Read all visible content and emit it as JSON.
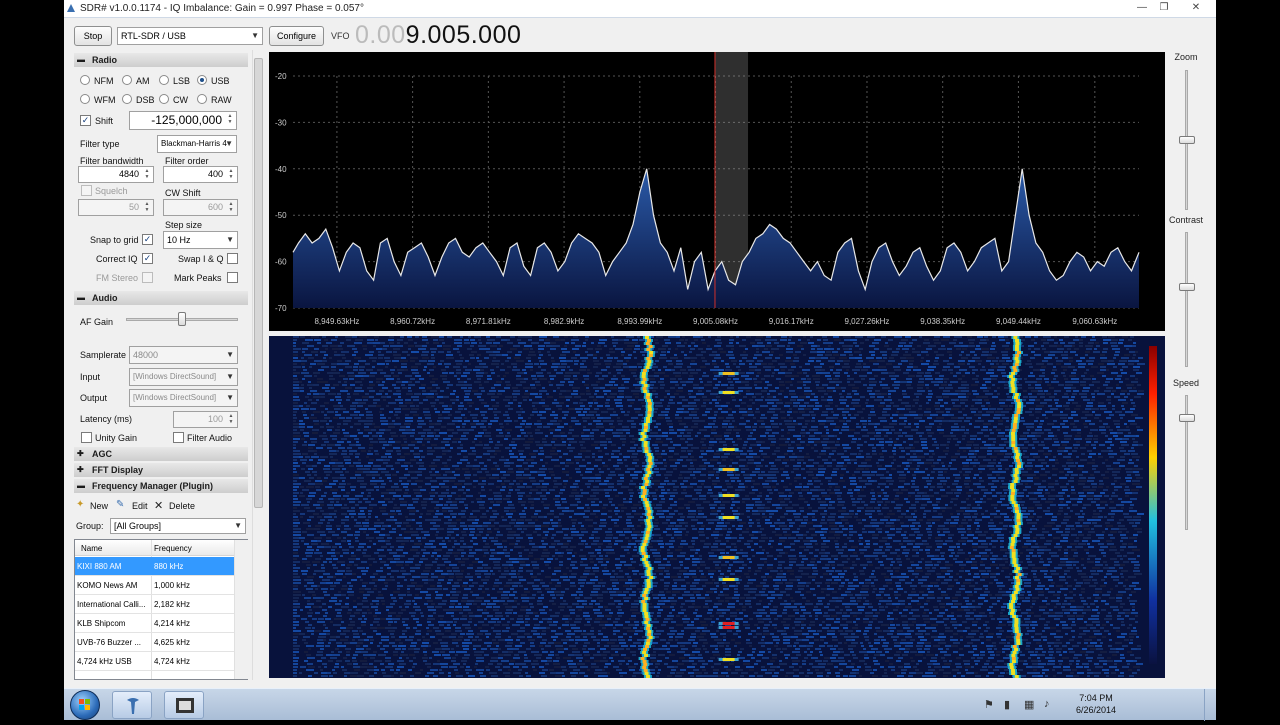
{
  "window": {
    "title": "SDR# v1.0.0.1174 - IQ Imbalance: Gain = 0.997 Phase = 0.057°",
    "minimize": "—",
    "maximize": "❐",
    "close": "✕"
  },
  "toolbar": {
    "stop_label": "Stop",
    "source_value": "RTL-SDR / USB",
    "configure_label": "Configure",
    "vfo_label": "VFO",
    "vfo_dim": "0.00",
    "vfo_value": "9.005.000"
  },
  "radio": {
    "header": "Radio",
    "toggle": "▬",
    "modes": [
      {
        "label": "NFM",
        "selected": false
      },
      {
        "label": "AM",
        "selected": false
      },
      {
        "label": "LSB",
        "selected": false
      },
      {
        "label": "USB",
        "selected": true
      },
      {
        "label": "WFM",
        "selected": false
      },
      {
        "label": "DSB",
        "selected": false
      },
      {
        "label": "CW",
        "selected": false
      },
      {
        "label": "RAW",
        "selected": false
      }
    ],
    "shift_label": "Shift",
    "shift_value": "-125,000,000",
    "filter_type_label": "Filter type",
    "filter_type_value": "Blackman-Harris 4",
    "filter_bandwidth_label": "Filter bandwidth",
    "filter_bandwidth_value": "4840",
    "filter_order_label": "Filter order",
    "filter_order_value": "400",
    "squelch_label": "Squelch",
    "squelch_value": "50",
    "cw_shift_label": "CW Shift",
    "cw_shift_value": "600",
    "step_size_label": "Step size",
    "step_size_value": "10 Hz",
    "snap_label": "Snap to grid",
    "correct_iq_label": "Correct IQ",
    "swap_iq_label": "Swap I & Q",
    "fm_stereo_label": "FM Stereo",
    "mark_peaks_label": "Mark Peaks",
    "check_mark": "✓"
  },
  "audio": {
    "header": "Audio",
    "toggle": "▬",
    "af_gain_label": "AF Gain",
    "af_gain_level": 0.5,
    "samplerate_label": "Samplerate",
    "samplerate_value": "48000",
    "input_label": "Input",
    "input_value": "[Windows DirectSound]",
    "output_label": "Output",
    "output_value": "[Windows DirectSound]",
    "latency_label": "Latency (ms)",
    "latency_value": "100",
    "unity_gain_label": "Unity Gain",
    "filter_audio_label": "Filter Audio"
  },
  "collapsed_sections": [
    {
      "label": "AGC",
      "toggle": "✚"
    },
    {
      "label": "FFT Display",
      "toggle": "✚"
    }
  ],
  "freq_manager": {
    "header": "Frequency Manager (Plugin)",
    "toggle": "▬",
    "new_label": "New",
    "edit_label": "Edit",
    "delete_label": "Delete",
    "group_label": "Group:",
    "group_value": "[All Groups]",
    "columns": [
      "Name",
      "Frequency"
    ],
    "rows": [
      {
        "name": "KIXI 880 AM",
        "freq": "880 kHz"
      },
      {
        "name": "KOMO News AM",
        "freq": "1,000 kHz"
      },
      {
        "name": "International Calli...",
        "freq": "2,182 kHz"
      },
      {
        "name": "KLB Shipcom",
        "freq": "4,214 kHz"
      },
      {
        "name": "UVB-76 Buzzer ...",
        "freq": "4,625 kHz"
      },
      {
        "name": "4,724 kHz USB",
        "freq": "4,724 kHz"
      }
    ]
  },
  "right_panel": {
    "zoom_label": "Zoom",
    "contrast_label": "Contrast",
    "speed_label": "Speed",
    "zoom_level": 0.5,
    "contrast_level": 0.6,
    "speed_level": 0.15
  },
  "taskbar": {
    "time": "7:04 PM",
    "date": "6/26/2014",
    "tray_icons": [
      "flag-icon",
      "battery-icon",
      "network-icon",
      "speaker-icon"
    ]
  },
  "chart_data": {
    "type": "line",
    "title": "",
    "xlabel": "",
    "ylabel": "",
    "ylim": [
      -70,
      -20
    ],
    "xlim": [
      8943.2,
      9067.1
    ],
    "y_ticks": [
      "-20",
      "-30",
      "-40",
      "-50",
      "-60",
      "-70"
    ],
    "x_ticks": [
      {
        "value": 8949.63,
        "label": "8,949.63kHz"
      },
      {
        "value": 8960.72,
        "label": "8,960.72kHz"
      },
      {
        "value": 8971.81,
        "label": "8,971.81kHz"
      },
      {
        "value": 8982.9,
        "label": "8,982.9kHz"
      },
      {
        "value": 8993.99,
        "label": "8,993.99kHz"
      },
      {
        "value": 9005.08,
        "label": "9,005.08kHz"
      },
      {
        "value": 9016.17,
        "label": "9,016.17kHz"
      },
      {
        "value": 9027.26,
        "label": "9,027.26kHz"
      },
      {
        "value": 9038.35,
        "label": "9,038.35kHz"
      },
      {
        "value": 9049.44,
        "label": "9,049.44kHz"
      },
      {
        "value": 9060.63,
        "label": "9,060.63kHz"
      }
    ],
    "vfo_khz": 9005.0,
    "filter_khz": [
      9005.0,
      9009.84
    ],
    "series": [
      {
        "x": [
          8943.2,
          8944.0,
          8945.0,
          8946.0,
          8947.0,
          8948.0,
          8949.0,
          8950.0,
          8951.0,
          8952.0,
          8953.0,
          8954.0,
          8955.0,
          8956.0,
          8957.0,
          8958.0,
          8959.0,
          8960.0,
          8961.0,
          8962.0,
          8963.0,
          8964.0,
          8965.0,
          8966.0,
          8967.0,
          8968.0,
          8969.0,
          8970.0,
          8971.0,
          8972.0,
          8973.0,
          8974.0,
          8975.0,
          8976.0,
          8977.0,
          8978.0,
          8979.0,
          8980.0,
          8981.0,
          8982.0,
          8983.0,
          8984.0,
          8985.0,
          8986.0,
          8987.0,
          8988.0,
          8989.0,
          8990.0,
          8991.0,
          8992.0,
          8993.0,
          8994.0,
          8995.0,
          8996.0,
          8997.0,
          8998.0,
          8999.0,
          9000.0,
          9001.0,
          9002.0,
          9003.0,
          9004.0,
          9005.0,
          9006.0,
          9007.0,
          9008.0,
          9009.0,
          9010.0,
          9011.0,
          9012.0,
          9013.0,
          9014.0,
          9015.0,
          9016.0,
          9017.0,
          9018.0,
          9019.0,
          9020.0,
          9021.0,
          9022.0,
          9023.0,
          9024.0,
          9025.0,
          9026.0,
          9027.0,
          9028.0,
          9029.0,
          9030.0,
          9031.0,
          9032.0,
          9033.0,
          9034.0,
          9035.0,
          9036.0,
          9037.0,
          9038.0,
          9039.0,
          9040.0,
          9041.0,
          9042.0,
          9043.0,
          9044.0,
          9045.0,
          9046.0,
          9047.0,
          9048.0,
          9049.0,
          9050.0,
          9051.0,
          9052.0,
          9053.0,
          9054.0,
          9055.0,
          9056.0,
          9057.0,
          9058.0,
          9059.0,
          9060.0,
          9061.0,
          9062.0,
          9063.0,
          9064.0,
          9065.0,
          9066.0,
          9067.1
        ],
        "y": [
          -58,
          -56,
          -54,
          -56,
          -55,
          -53,
          -57,
          -62,
          -58,
          -56,
          -57,
          -62,
          -64,
          -56,
          -55,
          -60,
          -63,
          -58,
          -57,
          -56,
          -59,
          -63,
          -59,
          -56,
          -55,
          -58,
          -59,
          -57,
          -56,
          -58,
          -60,
          -63,
          -57,
          -56,
          -61,
          -63,
          -57,
          -56,
          -58,
          -62,
          -60,
          -56,
          -54,
          -55,
          -56,
          -58,
          -63,
          -60,
          -58,
          -56,
          -52,
          -45,
          -40,
          -50,
          -56,
          -58,
          -62,
          -57,
          -66,
          -60,
          -58,
          -66,
          -62,
          -60,
          -64,
          -65,
          -60,
          -58,
          -55,
          -54,
          -52,
          -53,
          -55,
          -56,
          -58,
          -60,
          -62,
          -60,
          -63,
          -64,
          -58,
          -56,
          -55,
          -62,
          -66,
          -60,
          -57,
          -56,
          -60,
          -63,
          -61,
          -58,
          -57,
          -61,
          -64,
          -62,
          -57,
          -56,
          -58,
          -62,
          -60,
          -57,
          -56,
          -55,
          -62,
          -60,
          -50,
          -40,
          -50,
          -56,
          -58,
          -62,
          -64,
          -63,
          -60,
          -58,
          -59,
          -62,
          -60,
          -61,
          -58,
          -57,
          -60,
          -62,
          -58
        ]
      }
    ]
  }
}
